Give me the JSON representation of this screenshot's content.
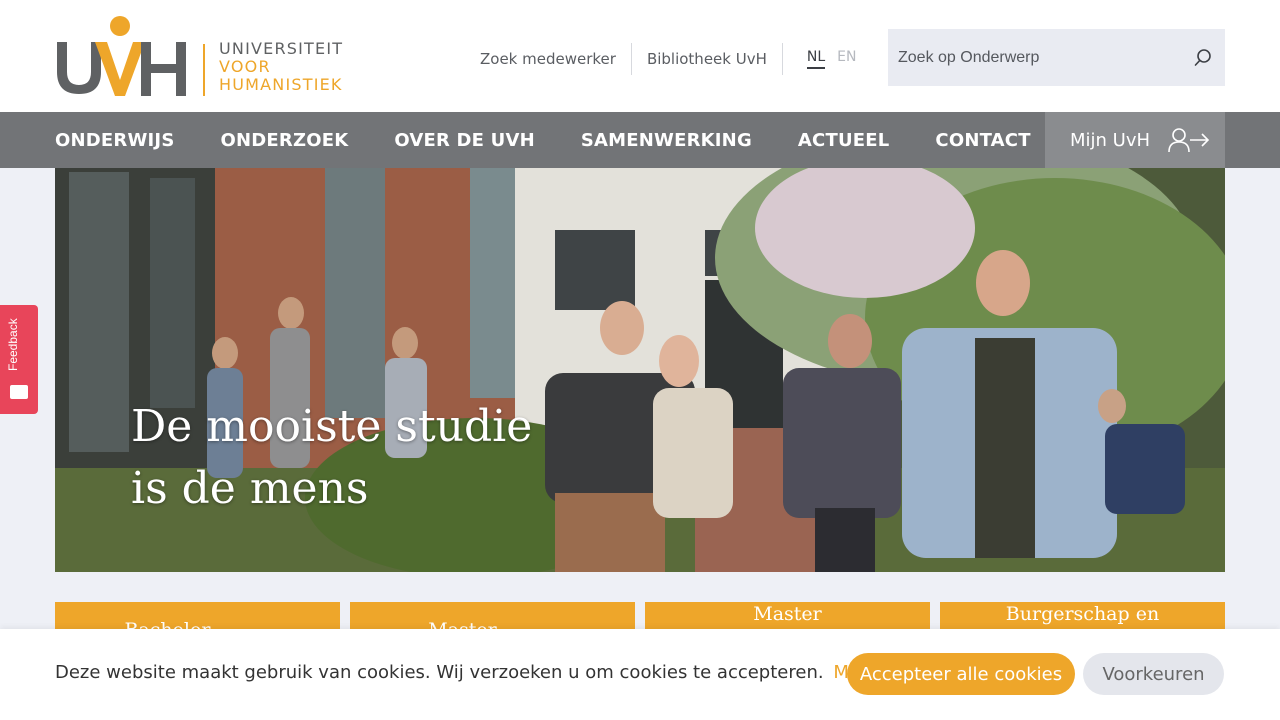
{
  "logo": {
    "letters": "UVH",
    "line1": "UNIVERSITEIT",
    "line2": "VOOR",
    "line3": "HUMANISTIEK",
    "colors": {
      "grey": "#5f6163",
      "orange": "#eea62a"
    }
  },
  "toplinks": {
    "staff": "Zoek medewerker",
    "library": "Bibliotheek UvH"
  },
  "language": {
    "nl": "NL",
    "en": "EN",
    "active": "NL"
  },
  "search": {
    "placeholder": "Zoek op Onderwerp",
    "icon": "search-icon"
  },
  "nav": {
    "items": [
      "ONDERWIJS",
      "ONDERZOEK",
      "OVER DE UVH",
      "SAMENWERKING",
      "ACTUEEL",
      "CONTACT"
    ],
    "account_label": "Mijn UvH",
    "account_icon": "user-login-icon"
  },
  "hero": {
    "line1": "De mooiste studie",
    "line2": "is de mens"
  },
  "feedback": {
    "label": "Feedback",
    "icon": "feedback-icon"
  },
  "tiles": [
    {
      "label": "Bachelor"
    },
    {
      "label": "Master"
    },
    {
      "label": "Master"
    },
    {
      "label": "Burgerschap en"
    }
  ],
  "cookie": {
    "message": "Deze website maakt gebruik van cookies. Wij verzoeken u om cookies te accepteren.",
    "more_link": "Meer info",
    "accept": "Accepteer alle cookies",
    "preferences": "Voorkeuren"
  },
  "colors": {
    "accent": "#eea62a",
    "nav_bg": "#727477",
    "account_bg": "#8a8c8f",
    "feedback": "#e8455a"
  }
}
